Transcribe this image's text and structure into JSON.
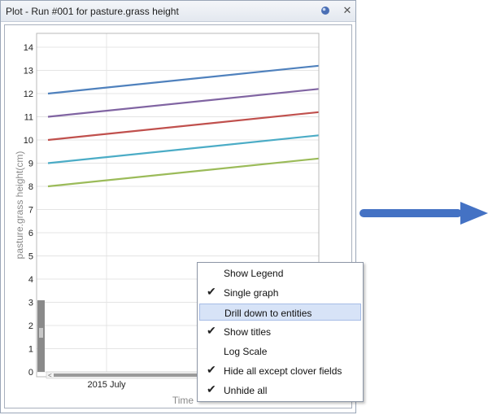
{
  "window": {
    "title": "Plot - Run #001 for pasture.grass height"
  },
  "icons": {
    "pin": "pin-icon",
    "close": "close-icon",
    "check": "check-icon",
    "arrow": "arrow-right-icon"
  },
  "colors": {
    "line1": "#4f81bd",
    "line2": "#8064a2",
    "line3": "#c0504d",
    "line4": "#4bacc6",
    "line5": "#9bbb59",
    "arrow": "#4472c4",
    "menu_highlight": "#d7e3f7"
  },
  "chart_data": {
    "type": "line",
    "ylabel": "pasture.grass height(cm)",
    "xlabel": "Time",
    "x_tick_labels": [
      "2015 July"
    ],
    "ylim": [
      0,
      14
    ],
    "yticks": [
      0,
      1,
      2,
      3,
      4,
      5,
      6,
      7,
      8,
      9,
      10,
      11,
      12,
      13,
      14
    ],
    "grid": true,
    "series": [
      {
        "color": "#4f81bd",
        "values": [
          12,
          13.2
        ]
      },
      {
        "color": "#8064a2",
        "values": [
          11,
          12.2
        ]
      },
      {
        "color": "#c0504d",
        "values": [
          10,
          11.2
        ]
      },
      {
        "color": "#4bacc6",
        "values": [
          9,
          10.2
        ]
      },
      {
        "color": "#9bbb59",
        "values": [
          8,
          9.2
        ]
      }
    ]
  },
  "context_menu": {
    "items": [
      {
        "label": "Show Legend",
        "checked": false,
        "highlighted": false
      },
      {
        "label": "Single graph",
        "checked": true,
        "highlighted": false
      },
      {
        "label": "Drill down to entities",
        "checked": false,
        "highlighted": true
      },
      {
        "label": "Show titles",
        "checked": true,
        "highlighted": false
      },
      {
        "label": "Log Scale",
        "checked": false,
        "highlighted": false
      },
      {
        "label": "Hide all except clover fields",
        "checked": true,
        "highlighted": false
      },
      {
        "label": "Unhide all",
        "checked": true,
        "highlighted": false
      }
    ]
  }
}
